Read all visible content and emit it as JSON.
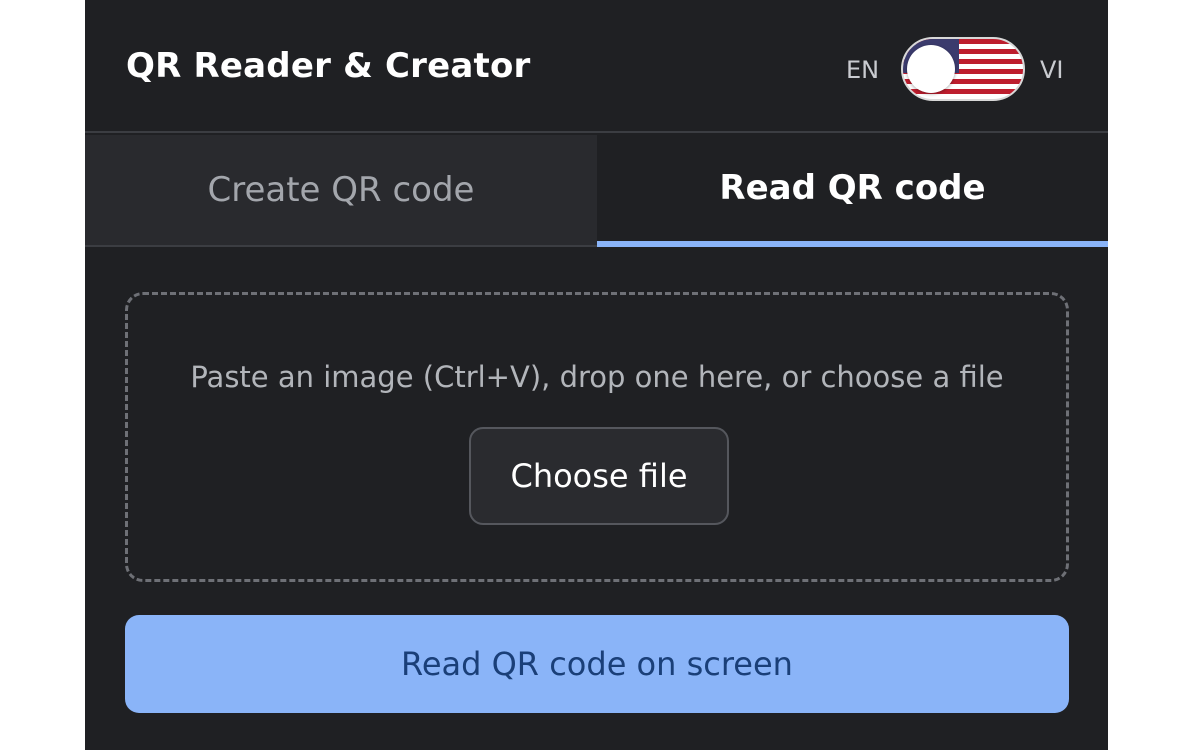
{
  "header": {
    "title": "QR Reader & Creator",
    "lang_left": "EN",
    "lang_right": "VI",
    "toggle_icon": "us-flag-icon"
  },
  "tabs": [
    {
      "label": "Create QR code",
      "active": false
    },
    {
      "label": "Read QR code",
      "active": true
    }
  ],
  "dropzone": {
    "instruction": "Paste an image (Ctrl+V), drop one here, or choose a file",
    "choose_label": "Choose file"
  },
  "actions": {
    "read_screen_label": "Read QR code on screen"
  },
  "colors": {
    "background": "#1f2023",
    "accent": "#8ab4f8",
    "accent_text": "#1a3f78"
  }
}
